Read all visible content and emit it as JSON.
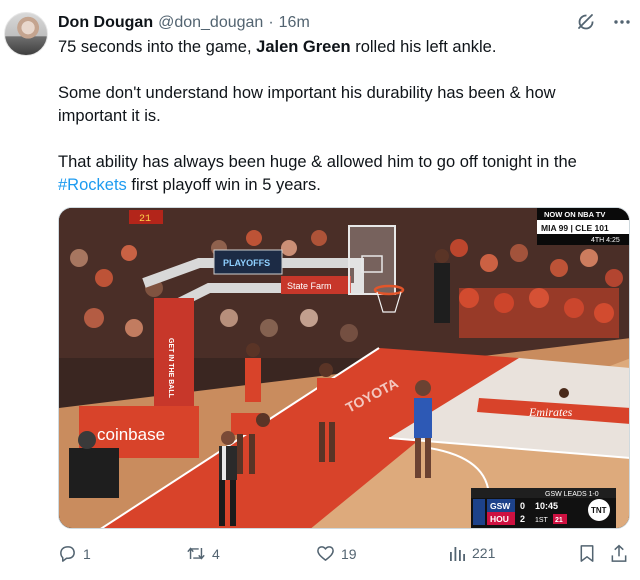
{
  "author": {
    "name": "Don Dougan",
    "handle": "@don_dougan",
    "separator": "·",
    "time": "16m"
  },
  "body": {
    "p1_pre": "75 seconds into the game, ",
    "p1_bold": "Jalen Green",
    "p1_post": " rolled his left ankle.",
    "p2": "Some don't understand how important his durability has been & how important it is.",
    "p3_pre": "That ability has always been huge & allowed him to go off tonight in the ",
    "p3_hashtag": "#Rockets",
    "p3_post": " first playoff win in 5 years."
  },
  "media": {
    "corner_banner": "NOW ON NBA TV",
    "corner_score": "MIA  99 | CLE  101",
    "corner_period": "4TH 4:25",
    "arena_scoreboard": "21",
    "arena_playoffs": "PLAYOFFS",
    "arena_statefarm": "State Farm",
    "court_logo": "TOYOTA",
    "sign_emirates": "Emirates",
    "sign_coinbase": "coinbase",
    "stanchion_text": "GET IN THE BALL",
    "scorebug": {
      "series_label": "GSW LEADS 1-0",
      "team1": "GSW",
      "score1": "0",
      "team2": "HOU",
      "score2": "2",
      "clock": "10:45",
      "period": "1ST",
      "shot_clock": "21",
      "network": "TNT"
    }
  },
  "actions": {
    "replies": "1",
    "retweets": "4",
    "likes": "19",
    "views": "221"
  },
  "colors": {
    "link": "#1d9bf0",
    "muted": "#536471",
    "rockets_red": "#ce1141"
  },
  "icons": [
    "grok-icon",
    "more-icon",
    "reply-icon",
    "retweet-icon",
    "like-icon",
    "views-icon",
    "bookmark-icon",
    "share-icon"
  ]
}
